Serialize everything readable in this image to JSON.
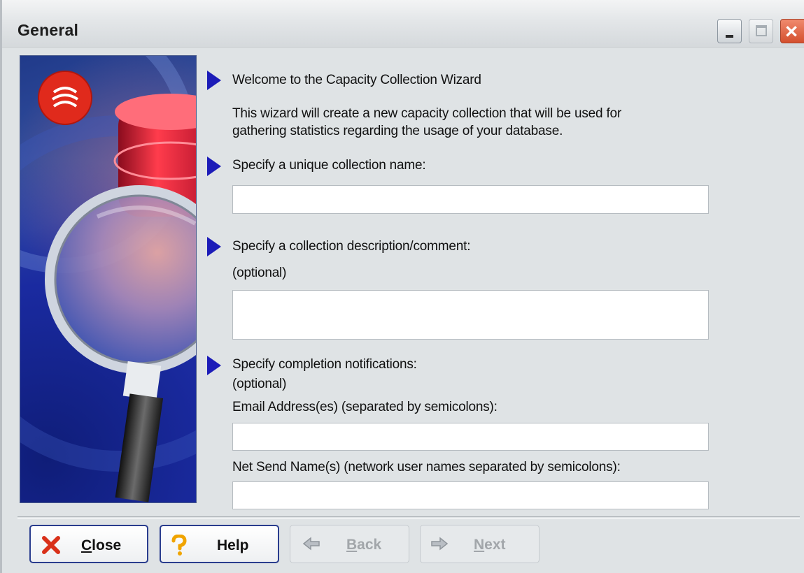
{
  "window": {
    "title": "General",
    "controls": [
      "minimize",
      "maximize",
      "close"
    ]
  },
  "wizard": {
    "welcome_heading": "Welcome to the Capacity Collection Wizard",
    "intro_line1": "This wizard will create a new capacity collection that will be used for",
    "intro_line2": "gathering statistics regarding the usage of your database.",
    "name_label": "Specify a unique collection name:",
    "name_value": "",
    "description_label": "Specify a collection description/comment:",
    "description_optional": "(optional)",
    "description_value": "",
    "notify_label": "Specify completion notifications:",
    "notify_optional": "(optional)",
    "email_label": "Email Address(es) (separated by semicolons):",
    "email_value": "",
    "netsend_label": "Net Send Name(s) (network user names separated by semicolons):",
    "netsend_value": ""
  },
  "buttons": {
    "close_prefix": "",
    "close_mnemonic": "C",
    "close_rest": "lose",
    "help": "Help",
    "back_mnemonic": "B",
    "back_rest": "ack",
    "next_mnemonic": "N",
    "next_rest": "ext"
  },
  "colors": {
    "accent_arrow": "#1c1cb8",
    "close_x": "#d9311a",
    "help_q": "#f0a400",
    "button_border": "#2a3d8e"
  }
}
